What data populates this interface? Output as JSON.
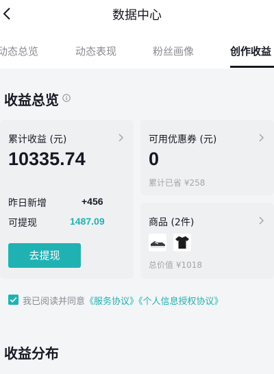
{
  "header": {
    "title": "数据中心"
  },
  "tabs": [
    {
      "label": "动态总览"
    },
    {
      "label": "动态表现"
    },
    {
      "label": "粉丝画像"
    },
    {
      "label": "创作收益"
    }
  ],
  "overview": {
    "title": "收益总览",
    "cumulative": {
      "label": "累计收益 (元)",
      "value": "10335.74",
      "yesterday_label": "昨日新增",
      "yesterday_value": "+456",
      "withdrawable_label": "可提现",
      "withdrawable_value": "1487.09",
      "withdraw_button": "去提现"
    },
    "coupon": {
      "label": "可用优惠券 (元)",
      "value": "0",
      "saved_text": "累计已省 ¥258"
    },
    "goods": {
      "label": "商品 (2件)",
      "total_text": "总价值 ¥1018",
      "items": [
        {
          "icon": "sneaker-thumbnail"
        },
        {
          "icon": "tshirt-thumbnail"
        }
      ]
    }
  },
  "agreement": {
    "prefix": "我已阅读并同意",
    "link1": "《服务协议》",
    "link2": "《个人信息授权协议》",
    "checked": true
  },
  "distribution": {
    "title": "收益分布"
  },
  "colors": {
    "accent": "#20b2b3",
    "text": "#161823",
    "muted": "#8a8b91"
  }
}
